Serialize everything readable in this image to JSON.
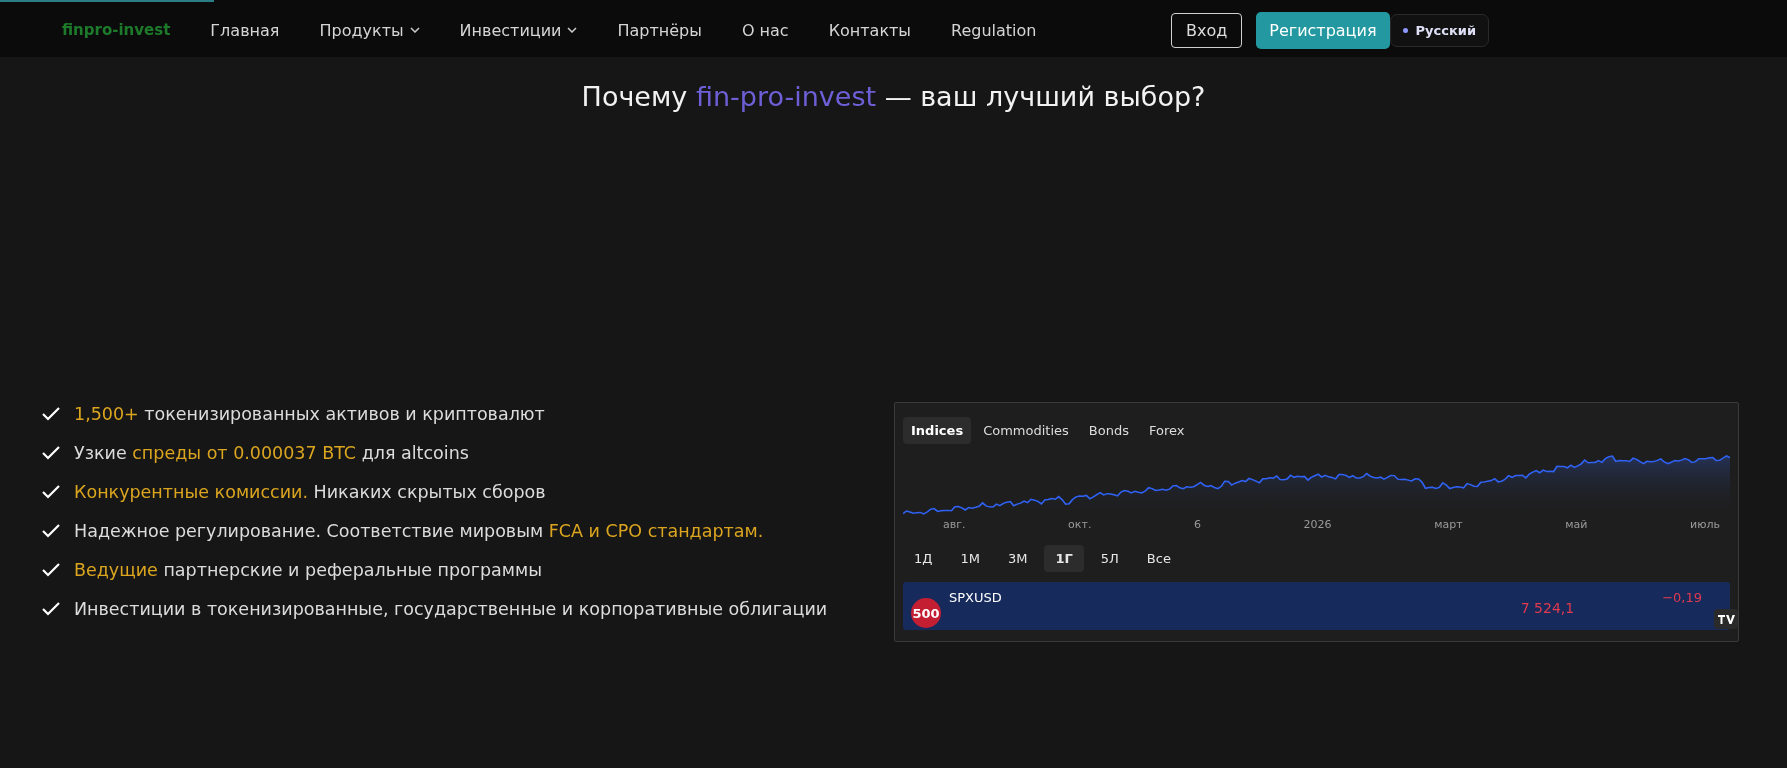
{
  "scroll_progress": {
    "level": 0.12
  },
  "header": {
    "logo": "finpro-invest",
    "nav": [
      {
        "label": "Главная",
        "dropdown": false
      },
      {
        "label": "Продукты",
        "dropdown": true
      },
      {
        "label": "Инвестиции",
        "dropdown": true
      },
      {
        "label": "Партнёры",
        "dropdown": false
      },
      {
        "label": "О нас",
        "dropdown": false
      },
      {
        "label": "Контакты",
        "dropdown": false
      },
      {
        "label": "Regulation",
        "dropdown": false
      }
    ],
    "login": "Вход",
    "register": "Регистрация",
    "language": "Русский"
  },
  "title": {
    "before": "Почему ",
    "brand": "fin-pro-invest",
    "after": " — ваш лучший выбор?"
  },
  "features": [
    [
      {
        "text": "1,500+",
        "highlight": true
      },
      {
        "text": " токенизированных активов и криптовалют",
        "highlight": false
      }
    ],
    [
      {
        "text": "Узкие ",
        "highlight": false
      },
      {
        "text": "спреды от 0.000037 BTC",
        "highlight": true
      },
      {
        "text": " для altcoins",
        "highlight": false
      }
    ],
    [
      {
        "text": "Конкурентные комиссии.",
        "highlight": true
      },
      {
        "text": " Никаких скрытых сборов",
        "highlight": false
      }
    ],
    [
      {
        "text": "Надежное регулирование. Соответствие мировым ",
        "highlight": false
      },
      {
        "text": "FCA и CPO стандартам.",
        "highlight": true
      }
    ],
    [
      {
        "text": "Ведущие",
        "highlight": true
      },
      {
        "text": " партнерские и реферальные программы",
        "highlight": false
      }
    ],
    [
      {
        "text": "Инвестиции в токенизированные, государственные и корпоративные облигации",
        "highlight": false
      }
    ]
  ],
  "widget": {
    "tabs": [
      {
        "label": "Indices",
        "selected": true
      },
      {
        "label": "Commodities",
        "selected": false
      },
      {
        "label": "Bonds",
        "selected": false
      },
      {
        "label": "Forex",
        "selected": false
      }
    ],
    "axis_labels": [
      "авг.",
      "окт.",
      "6",
      "2026",
      "март",
      "май",
      "июль"
    ],
    "ranges": [
      {
        "label": "1Д",
        "selected": false
      },
      {
        "label": "1М",
        "selected": false
      },
      {
        "label": "3М",
        "selected": false
      },
      {
        "label": "1Г",
        "selected": true
      },
      {
        "label": "5Л",
        "selected": false
      },
      {
        "label": "Все",
        "selected": false
      }
    ],
    "symbol": {
      "badge": "500",
      "name": "SPXUSD",
      "price": "7 524,1",
      "change": "−0,19"
    }
  }
}
